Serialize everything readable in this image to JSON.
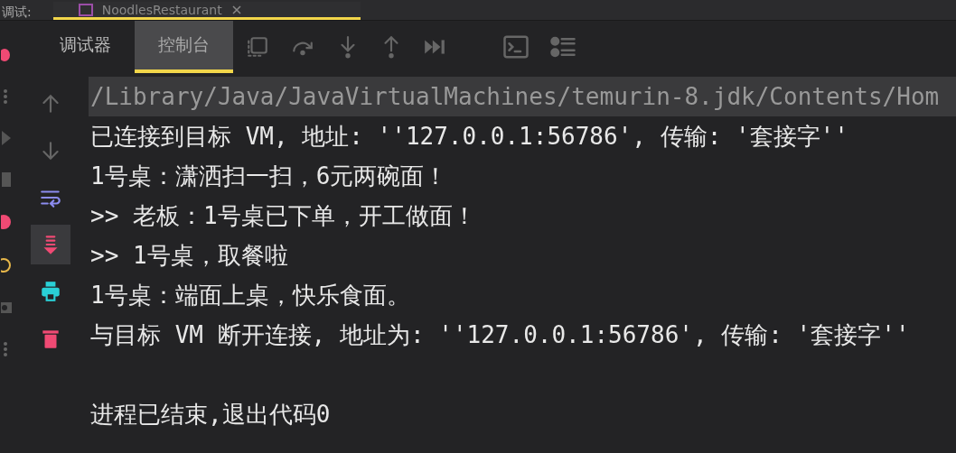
{
  "run_bar": {
    "label": "调试:",
    "tabs": [
      {
        "label": "NoodlesRestaurant",
        "selected": true
      }
    ]
  },
  "debug_tabs": [
    {
      "label": "调试器",
      "selected": false
    },
    {
      "label": "控制台",
      "selected": true
    }
  ],
  "console_actions": [
    {
      "kind": "up",
      "selected": false
    },
    {
      "kind": "down",
      "selected": false
    },
    {
      "kind": "wrap",
      "selected": false
    },
    {
      "kind": "scroll-end",
      "selected": true
    },
    {
      "kind": "print",
      "selected": false
    },
    {
      "kind": "clear",
      "selected": false
    }
  ],
  "console_lines": [
    {
      "kind": "command",
      "text": "/Library/Java/JavaVirtualMachines/temurin-8.jdk/Contents/Hom"
    },
    {
      "kind": "output",
      "text": "已连接到目标 VM, 地址: ''127.0.0.1:56786', 传输: '套接字''"
    },
    {
      "kind": "output",
      "text": "1号桌：潇洒扫一扫，6元两碗面！"
    },
    {
      "kind": "output",
      "text": ">> 老板：1号桌已下单，开工做面！"
    },
    {
      "kind": "output",
      "text": ">> 1号桌，取餐啦"
    },
    {
      "kind": "output",
      "text": "1号桌：端面上桌，快乐食面。"
    },
    {
      "kind": "output",
      "text": "与目标 VM 断开连接, 地址为: ''127.0.0.1:56786', 传输: '套接字''"
    },
    {
      "kind": "exit",
      "text": "进程已结束,退出代码0"
    }
  ]
}
